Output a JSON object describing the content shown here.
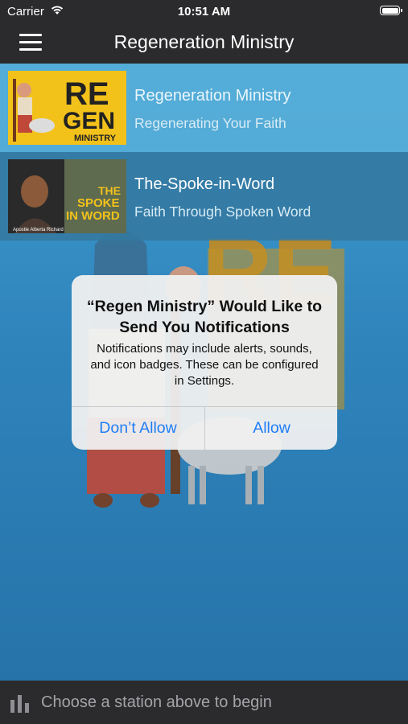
{
  "status_bar": {
    "carrier": "Carrier",
    "time": "10:51 AM"
  },
  "nav": {
    "title": "Regeneration Ministry"
  },
  "stations": [
    {
      "name": "Regeneration Ministry",
      "subtitle": "Regenerating Your Faith",
      "logo_text": [
        "RE",
        "GEN",
        "MINISTRY"
      ]
    },
    {
      "name": "The-Spoke-in-Word",
      "subtitle": "Faith Through Spoken Word",
      "logo_text": [
        "THE",
        "SPOKE",
        "IN WORD"
      ],
      "caption": "Apostle Alberta Richard"
    }
  ],
  "alert": {
    "title": "“Regen Ministry” Would Like to Send You Notifications",
    "message": "Notifications may include alerts, sounds, and icon badges. These can be configured in Settings.",
    "deny_label": "Don’t Allow",
    "allow_label": "Allow"
  },
  "footer": {
    "text": "Choose a station above to begin"
  },
  "colors": {
    "accent": "#1f7ef5",
    "bar": "#2b2b2d",
    "background": "#2f7fb4"
  }
}
